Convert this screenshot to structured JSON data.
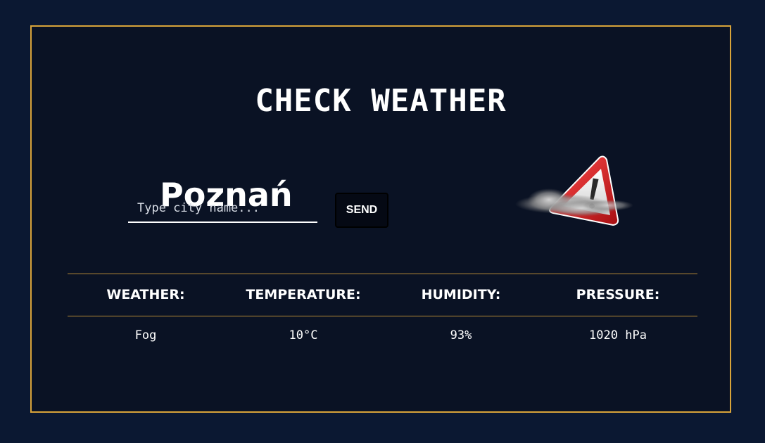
{
  "app": {
    "title": "CHECK WEATHER"
  },
  "location": {
    "city": "Poznań"
  },
  "search": {
    "placeholder": "Type city name...",
    "value": "",
    "send_label": "SEND"
  },
  "weather_icon": {
    "name": "fog-warning-icon"
  },
  "table": {
    "headers": {
      "weather": "WEATHER:",
      "temperature": "TEMPERATURE:",
      "humidity": "HUMIDITY:",
      "pressure": "PRESSURE:"
    },
    "values": {
      "weather": "Fog",
      "temperature": "10°C",
      "humidity": "93%",
      "pressure": "1020 hPa"
    }
  },
  "colors": {
    "page_background": "#0b1832",
    "card_background": "#0a1224",
    "accent_border": "#d9a43a",
    "divider": "#b88a35",
    "text": "#ffffff",
    "warning_red": "#d8141c"
  }
}
